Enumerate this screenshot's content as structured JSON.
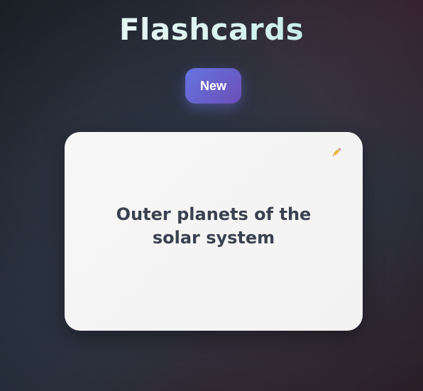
{
  "app": {
    "title": "Flashcards"
  },
  "toolbar": {
    "new_label": "New"
  },
  "card": {
    "text": "Outer planets of the solar system",
    "edit_icon": "pencil-icon"
  },
  "colors": {
    "accent_start": "#6674e0",
    "accent_end": "#6b4fb8",
    "card_background": "#f4f4f4",
    "card_text": "#3a4150",
    "title_text": "#c9f2ec"
  }
}
